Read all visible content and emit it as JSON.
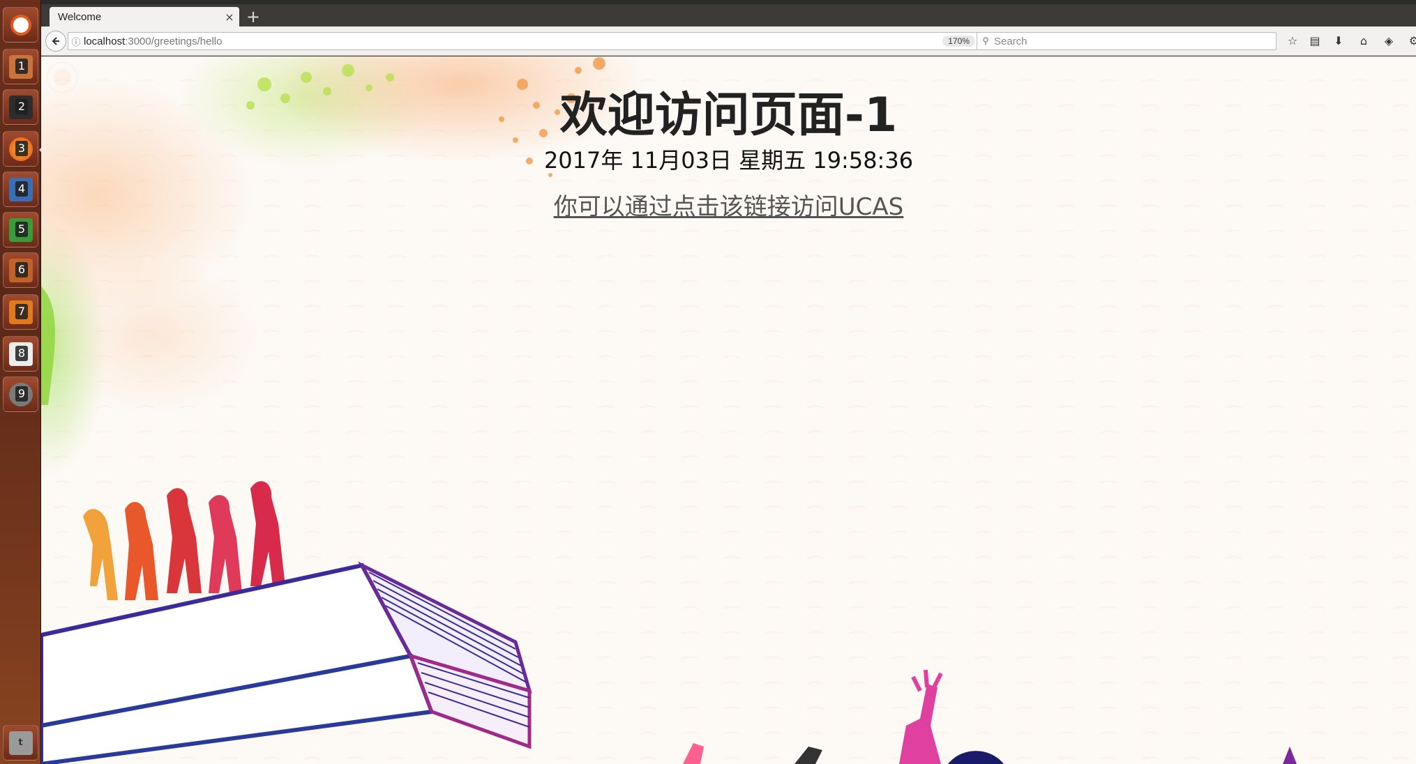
{
  "launcher": {
    "items": [
      {
        "num": "",
        "name": "ubuntu-dash-icon"
      },
      {
        "num": "1",
        "name": "files-icon"
      },
      {
        "num": "2",
        "name": "terminal-icon"
      },
      {
        "num": "3",
        "name": "firefox-icon"
      },
      {
        "num": "4",
        "name": "writer-icon"
      },
      {
        "num": "5",
        "name": "calc-icon"
      },
      {
        "num": "6",
        "name": "impress-icon"
      },
      {
        "num": "7",
        "name": "software-center-icon"
      },
      {
        "num": "8",
        "name": "amazon-icon"
      },
      {
        "num": "9",
        "name": "system-settings-icon"
      }
    ],
    "trash_label": "t"
  },
  "browser": {
    "tab_title": "Welcome",
    "tab_close": "×",
    "new_tab": "+",
    "url_host": "localhost",
    "url_path": ":3000/greetings/hello",
    "zoom": "170%",
    "search_placeholder": "Search"
  },
  "page": {
    "heading": "欢迎访问页面-1",
    "datetime": "2017年 11月03日 星期五 19:58:36",
    "link_text": "你可以通过点击该链接访问UCAS"
  },
  "colors": {
    "launcher_bg": "#6a2f1c",
    "chrome_bg": "#f2f1f0",
    "page_bg": "#fdf9f5",
    "heading": "#222222",
    "link": "#555555"
  }
}
